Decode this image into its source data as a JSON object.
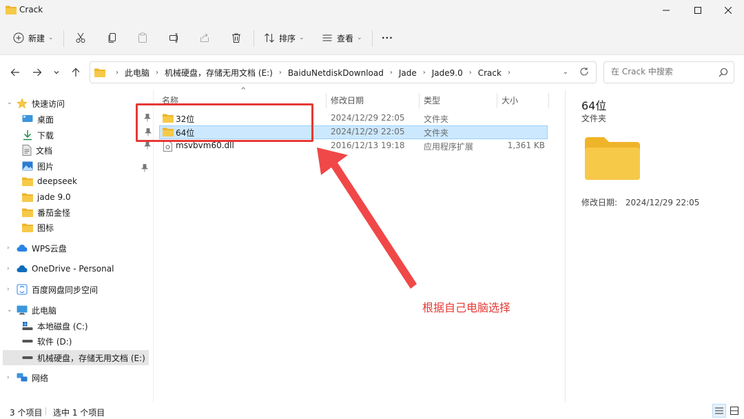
{
  "window": {
    "title": "Crack"
  },
  "toolbar": {
    "new_label": "新建",
    "sort_label": "排序",
    "view_label": "查看",
    "more_label": "···"
  },
  "address": {
    "crumbs": [
      "此电脑",
      "机械硬盘，存储无用文档 (E:)",
      "BaiduNetdiskDownload",
      "Jade",
      "Jade9.0",
      "Crack"
    ]
  },
  "search": {
    "placeholder": "在 Crack 中搜索"
  },
  "sidebar": {
    "quick_access": "快速访问",
    "pinned": [
      "桌面",
      "下载",
      "文档",
      "图片"
    ],
    "folders": [
      "deepseek",
      "jade 9.0",
      "番茄金怪",
      "图标"
    ],
    "wps": "WPS云盘",
    "onedrive": "OneDrive - Personal",
    "baidu": "百度网盘同步空间",
    "this_pc": "此电脑",
    "drives": [
      "本地磁盘 (C:)",
      "软件 (D:)",
      "机械硬盘，存储无用文档 (E:)"
    ],
    "network": "网络"
  },
  "columns": {
    "name": "名称",
    "modified": "修改日期",
    "type": "类型",
    "size": "大小"
  },
  "files": [
    {
      "name": "32位",
      "modified": "2024/12/29 22:05",
      "type": "文件夹",
      "size": ""
    },
    {
      "name": "64位",
      "modified": "2024/12/29 22:05",
      "type": "文件夹",
      "size": ""
    },
    {
      "name": "msvbvm60.dll",
      "modified": "2016/12/13 19:18",
      "type": "应用程序扩展",
      "size": "1,361 KB"
    }
  ],
  "details": {
    "title": "64位",
    "subtitle": "文件夹",
    "modified_label": "修改日期:",
    "modified_value": "2024/12/29 22:05"
  },
  "status": {
    "count": "3 个项目",
    "selected": "选中 1 个项目"
  },
  "annotation": {
    "text": "根据自己电脑选择"
  },
  "colors": {
    "folder": "#f7c948",
    "selection": "#cce8ff",
    "accent": "#0067c0",
    "annotation": "#e53935"
  }
}
